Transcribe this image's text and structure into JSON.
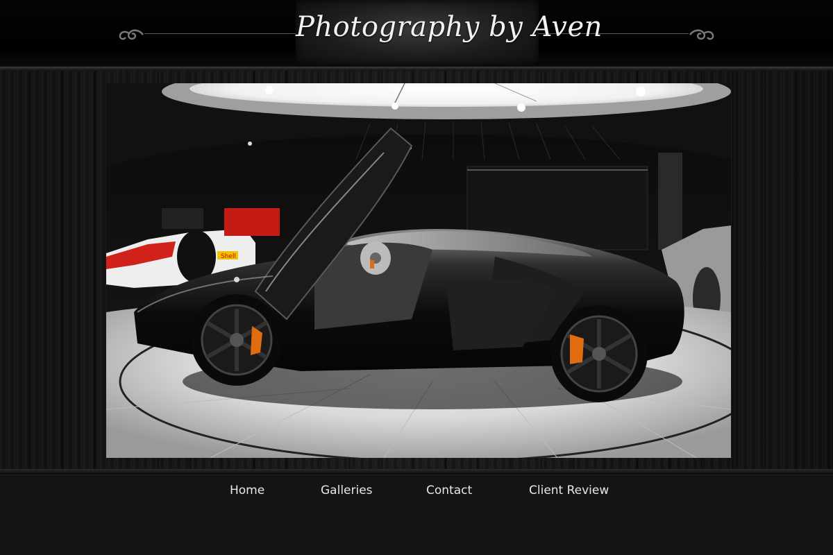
{
  "header": {
    "site_title": "Photography by Aven"
  },
  "photo": {
    "icon": "sports-car-photo"
  },
  "nav": {
    "items": [
      {
        "label": "Home"
      },
      {
        "label": "Galleries"
      },
      {
        "label": "Contact"
      },
      {
        "label": "Client Review"
      }
    ]
  },
  "colors": {
    "background": "#000000",
    "nav_background": "#141414",
    "title_text": "#f2f2f2",
    "nav_text": "#e8e8e8"
  }
}
